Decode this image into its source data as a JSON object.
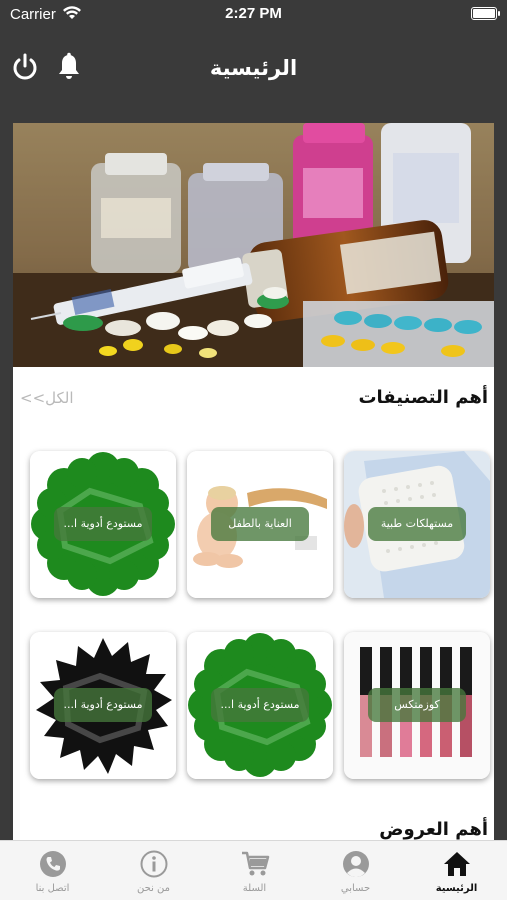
{
  "status_bar": {
    "carrier": "Carrier",
    "time": "2:27 PM"
  },
  "header": {
    "title": "الرئيسية"
  },
  "categories_section": {
    "title": "أهم التصنيفات",
    "see_all": "الكل>>",
    "items": [
      {
        "label": "مستهلكات طبية"
      },
      {
        "label": "العناية بالطفل"
      },
      {
        "label": "مستودع أدوية ا..."
      },
      {
        "label": "كوزمتكس"
      },
      {
        "label": "مستودع أدوية ا..."
      },
      {
        "label": "مستودع أدوية ا..."
      }
    ]
  },
  "second_section": {
    "title": "أهم العروض"
  },
  "tabs": [
    {
      "label": "الرئيسية",
      "icon": "home-icon",
      "active": true
    },
    {
      "label": "حسابي",
      "icon": "account-icon",
      "active": false
    },
    {
      "label": "السلة",
      "icon": "cart-icon",
      "active": false
    },
    {
      "label": "من نحن",
      "icon": "info-icon",
      "active": false
    },
    {
      "label": "اتصل بنا",
      "icon": "phone-icon",
      "active": false
    }
  ],
  "colors": {
    "bar": "#3a3a3a",
    "pill": "#46783c",
    "new_badge": "#1e8a1e",
    "tab_active": "#111111",
    "tab_inactive": "#9a9a9a"
  }
}
